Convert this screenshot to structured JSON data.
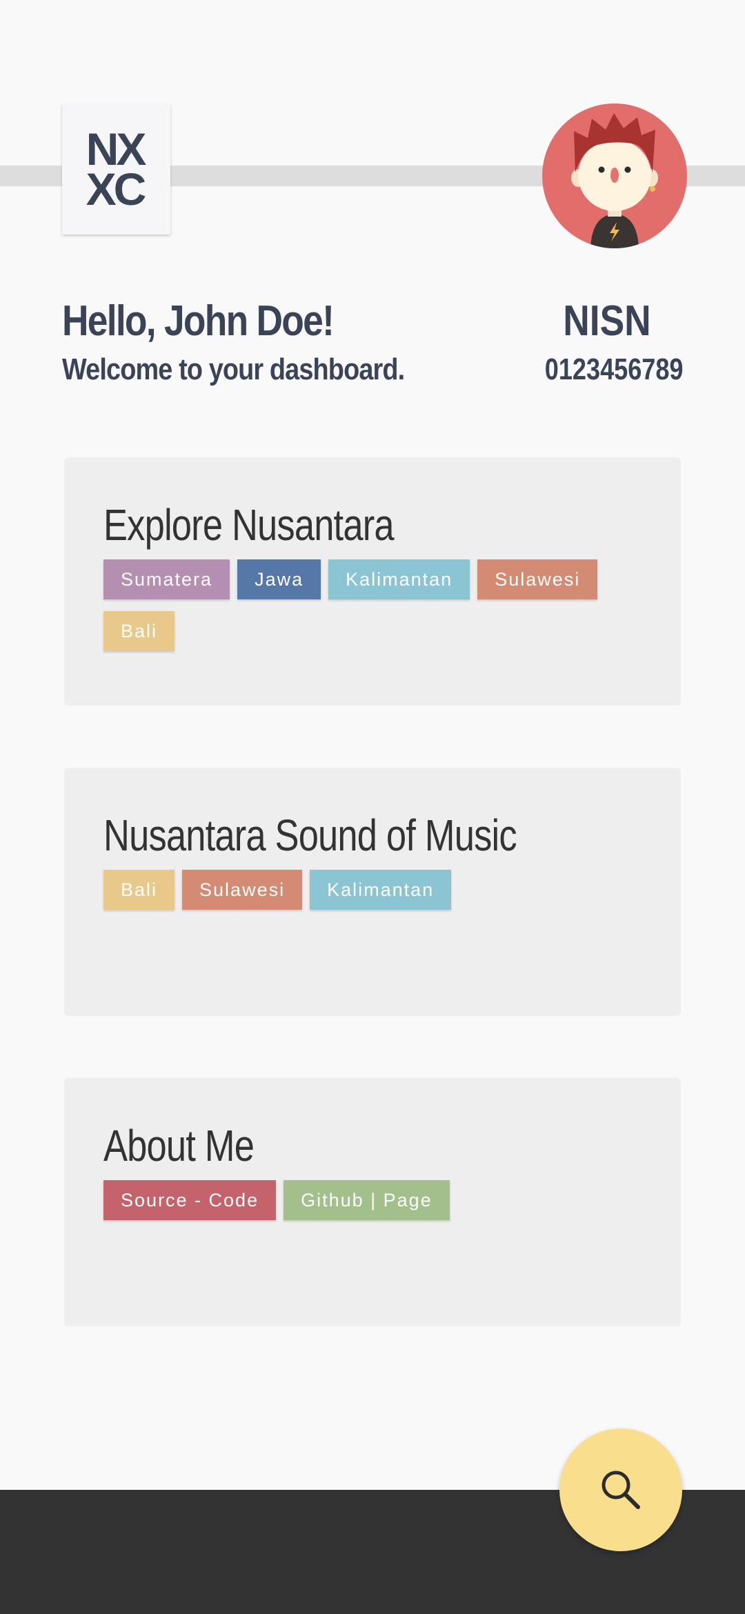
{
  "logo": {
    "line1": "NX",
    "line2": "XC"
  },
  "user": {
    "greeting": "Hello, John Doe!",
    "subtitle": "Welcome to your dashboard.",
    "id_label": "NISN",
    "id_value": "0123456789"
  },
  "cards": [
    {
      "title": "Explore Nusantara",
      "tags": [
        {
          "label": "Sumatera",
          "color": "#b58fb1"
        },
        {
          "label": "Jawa",
          "color": "#5578a8"
        },
        {
          "label": "Kalimantan",
          "color": "#8bc4d3"
        },
        {
          "label": "Sulawesi",
          "color": "#d48b73"
        },
        {
          "label": "Bali",
          "color": "#e8c98b"
        }
      ]
    },
    {
      "title": "Nusantara Sound of Music",
      "tags": [
        {
          "label": "Bali",
          "color": "#e8c98b"
        },
        {
          "label": "Sulawesi",
          "color": "#d48b73"
        },
        {
          "label": "Kalimantan",
          "color": "#8bc4d3"
        }
      ]
    },
    {
      "title": "About Me",
      "tags": [
        {
          "label": "Source - Code",
          "color": "#c5636d"
        },
        {
          "label": "Github | Page",
          "color": "#a3c08c"
        }
      ]
    }
  ],
  "fab": {
    "icon": "search-icon"
  },
  "colors": {
    "text_dark": "#3b4456",
    "avatar_bg": "#e26e6c",
    "fab_bg": "#f9de8d",
    "footer_bg": "#333333"
  }
}
